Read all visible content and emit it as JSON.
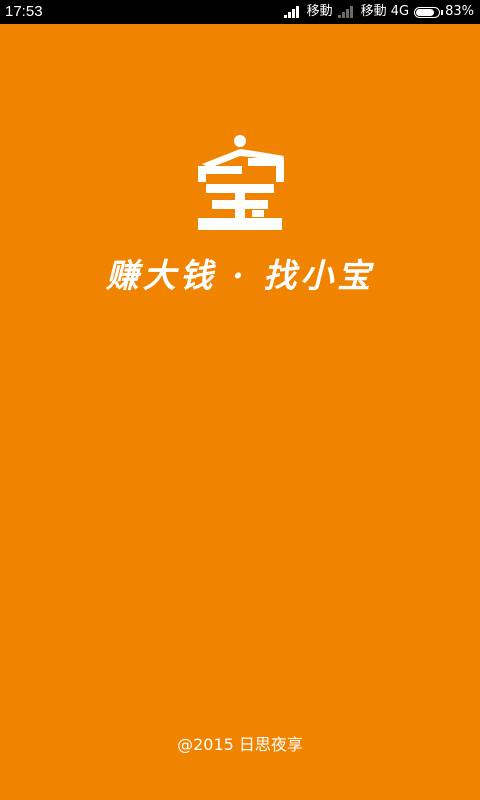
{
  "status_bar": {
    "time": "17:53",
    "carrier_1": "移動",
    "carrier_2": "移動 4G",
    "battery_percent": "83%",
    "battery_level": 0.83
  },
  "splash": {
    "logo_icon": "treasure-glyph-icon",
    "slogan": "赚大钱 · 找小宝",
    "copyright": "@2015 日思夜享"
  },
  "colors": {
    "background": "#f08300",
    "status_bar": "#000000",
    "text": "#ffffff"
  }
}
